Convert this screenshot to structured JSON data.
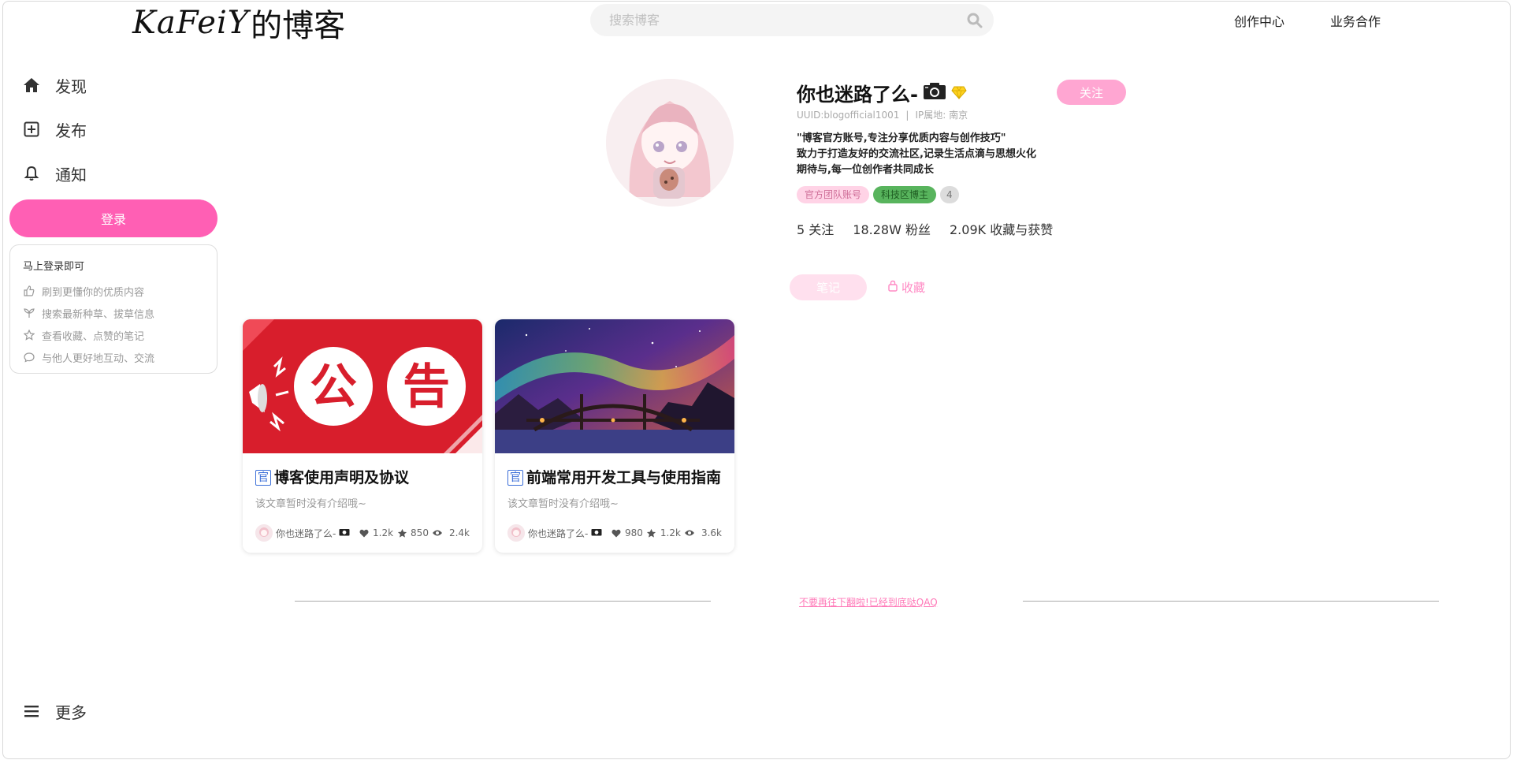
{
  "header": {
    "logo_script": "KaFeiY",
    "logo_cn": "的博客",
    "search_placeholder": "搜索博客",
    "links": [
      "创作中心",
      "业务合作"
    ]
  },
  "sidebar": {
    "items": [
      {
        "label": "发现",
        "icon": "home-icon"
      },
      {
        "label": "发布",
        "icon": "plus-square-icon"
      },
      {
        "label": "通知",
        "icon": "bell-icon"
      }
    ],
    "login_label": "登录",
    "login_card": {
      "title": "马上登录即可",
      "rows": [
        {
          "text": "刷到更懂你的优质内容",
          "icon": "thumbs-up-icon"
        },
        {
          "text": "搜索最新种草、拔草信息",
          "icon": "sprout-icon"
        },
        {
          "text": "查看收藏、点赞的笔记",
          "icon": "star-icon"
        },
        {
          "text": "与他人更好地互动、交流",
          "icon": "chat-bubble-icon"
        }
      ]
    },
    "more_label": "更多"
  },
  "profile": {
    "name": "你也迷路了么-",
    "follow_label": "关注",
    "uid": "UUID:blogofficial1001",
    "ip": "IP属地: 南京",
    "bio": [
      "\"博客官方账号,专注分享优质内容与创作技巧\"",
      "致力于打造友好的交流社区,记录生活点滴与思想火化",
      "期待与,每一位创作者共同成长"
    ],
    "tags": [
      "官方团队账号",
      "科技区博主",
      "4"
    ],
    "stats": {
      "following": "5 关注",
      "fans": "18.28W 粉丝",
      "likes": "2.09K 收藏与获赞"
    }
  },
  "tabs": {
    "notes": "笔记",
    "favorites": "收藏"
  },
  "cards": [
    {
      "badge": "官",
      "title": "博客使用声明及协议",
      "desc": "该文章暂时没有介绍哦~",
      "author": "你也迷路了么-",
      "likes": "1.2k",
      "stars": "850",
      "views": "2.4k",
      "cover_text": [
        "公",
        "告"
      ]
    },
    {
      "badge": "官",
      "title": "前端常用开发工具与使用指南",
      "desc": "该文章暂时没有介绍哦~",
      "author": "你也迷路了么-",
      "likes": "980",
      "stars": "1.2k",
      "views": "3.6k"
    }
  ],
  "end_text": "不要再往下翻啦!已经到底哒QAQ",
  "colors": {
    "accent": "#ff5fb4",
    "follow": "#ffa6d2",
    "end_text": "#ff79b8"
  }
}
